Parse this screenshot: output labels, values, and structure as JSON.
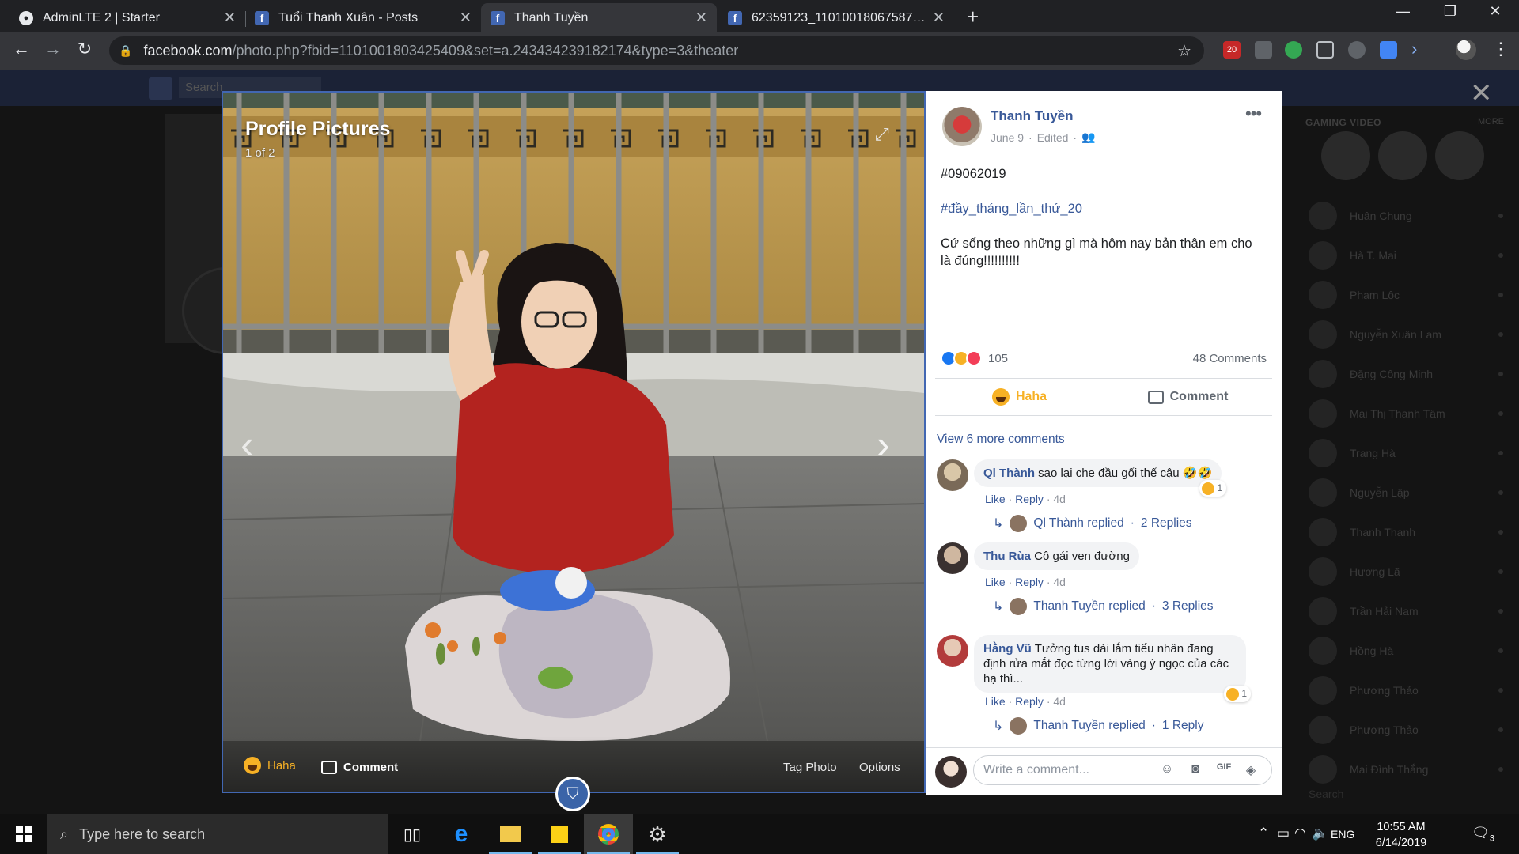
{
  "browser": {
    "tabs": [
      {
        "title": "AdminLTE 2 | Starter",
        "icon": "github-icon",
        "active": false
      },
      {
        "title": "Tuổi Thanh Xuân - Posts",
        "icon": "facebook-icon",
        "active": false
      },
      {
        "title": "Thanh Tuyền",
        "icon": "facebook-icon",
        "active": true
      },
      {
        "title": "62359123_1101001806758742_1...",
        "icon": "facebook-icon",
        "active": false
      }
    ],
    "url_host": "facebook.com",
    "url_path": "/photo.php?fbid=1101001803425409&set=a.243434239182174&type=3&theater",
    "extension_badge": "20"
  },
  "background": {
    "search_placeholder": "Search",
    "rail_title": "GAMING VIDEO",
    "rail_more": "MORE",
    "contacts": [
      "Huân Chung",
      "Hà T. Mai",
      "Phạm Lộc",
      "Nguyễn Xuân Lam",
      "Đặng Công Minh",
      "Mai Thị Thanh Tâm",
      "Trang Hà",
      "Nguyễn Lập",
      "Thanh Thanh",
      "Hương Lã",
      "Trần Hải Nam",
      "Hồng Hà",
      "Phương Thảo",
      "Phương Thảo",
      "Mai Đình Thắng"
    ],
    "rail_search": "Search"
  },
  "photo": {
    "album_title": "Profile Pictures",
    "counter": "1 of 2",
    "haha_label": "Haha",
    "comment_label": "Comment",
    "tag_label": "Tag Photo",
    "options_label": "Options"
  },
  "post": {
    "author": "Thanh Tuyền",
    "date": "June 9",
    "edited": "Edited",
    "line1": "#09062019",
    "hashtag": "#đầy_tháng_lần_thứ_20",
    "body": "Cứ sống theo những gì mà hôm nay bản thân em cho là đúng!!!!!!!!!!",
    "reaction_count": "105",
    "comment_count": "48 Comments",
    "haha_action": "Haha",
    "comment_action": "Comment",
    "view_more": "View 6 more comments",
    "composer_placeholder": "Write a comment..."
  },
  "comments": [
    {
      "author": "Ql Thành",
      "text": "sao lại che đầu gối thế cậu 🤣🤣",
      "reacts": "1",
      "like": "Like",
      "reply": "Reply",
      "time": "4d",
      "replied_by": "Ql Thành replied",
      "replies": "2 Replies"
    },
    {
      "author": "Thu Rùa",
      "text": "Cô gái ven đường",
      "reacts": "",
      "like": "Like",
      "reply": "Reply",
      "time": "4d",
      "replied_by": "Thanh Tuyền replied",
      "replies": "3 Replies"
    },
    {
      "author": "Hằng Vũ",
      "text": "Tưởng tus dài lắm tiểu nhân đang định rửa mắt đọc từng lời vàng ý ngọc của các hạ thì...",
      "reacts": "1",
      "like": "Like",
      "reply": "Reply",
      "time": "4d",
      "replied_by": "Thanh Tuyền replied",
      "replies": "1 Reply"
    }
  ],
  "taskbar": {
    "search_placeholder": "Type here to search",
    "lang": "ENG",
    "time": "10:55 AM",
    "date": "6/14/2019",
    "notifications": "3"
  },
  "colors": {
    "facebook_blue": "#4267b2",
    "link": "#385898",
    "haha": "#f7b125"
  }
}
